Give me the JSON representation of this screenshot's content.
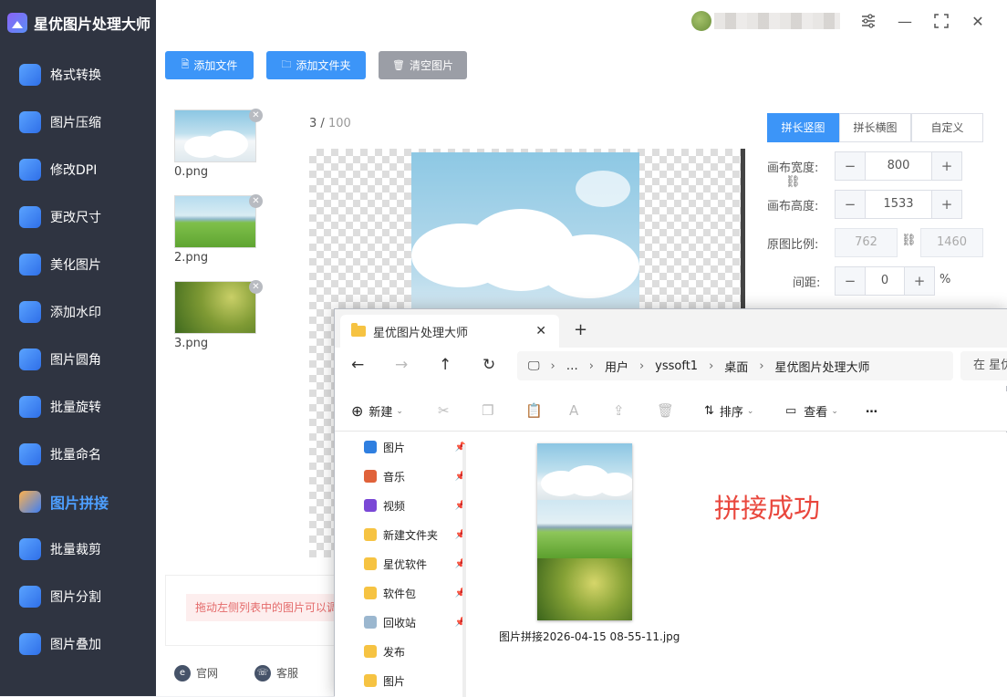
{
  "app": {
    "title": "星优图片处理大师"
  },
  "sidebar": {
    "items": [
      {
        "label": "格式转换",
        "icon": "image-convert-icon"
      },
      {
        "label": "图片压缩",
        "icon": "compress-icon"
      },
      {
        "label": "修改DPI",
        "icon": "dpi-icon"
      },
      {
        "label": "更改尺寸",
        "icon": "resize-icon"
      },
      {
        "label": "美化图片",
        "icon": "beautify-icon"
      },
      {
        "label": "添加水印",
        "icon": "watermark-icon"
      },
      {
        "label": "图片圆角",
        "icon": "round-corner-icon"
      },
      {
        "label": "批量旋转",
        "icon": "rotate-icon"
      },
      {
        "label": "批量命名",
        "icon": "rename-icon"
      },
      {
        "label": "图片拼接",
        "icon": "stitch-icon",
        "active": true
      },
      {
        "label": "批量裁剪",
        "icon": "crop-icon"
      },
      {
        "label": "图片分割",
        "icon": "split-icon"
      },
      {
        "label": "图片叠加",
        "icon": "overlay-icon"
      }
    ]
  },
  "toolbar": {
    "add_file": "添加文件",
    "add_folder": "添加文件夹",
    "clear": "清空图片"
  },
  "thumbs": [
    {
      "name": "0.png"
    },
    {
      "name": "2.png"
    },
    {
      "name": "3.png"
    }
  ],
  "preview": {
    "current": "3",
    "total": "100"
  },
  "settings": {
    "tabs": [
      "拼长竖图",
      "拼长横图",
      "自定义"
    ],
    "canvas_width_label": "画布宽度:",
    "canvas_width": "800",
    "canvas_height_label": "画布高度:",
    "canvas_height": "1533",
    "ratio_label": "原图比例:",
    "ratio_w": "762",
    "ratio_h": "1460",
    "spacing_label": "间距:",
    "spacing": "0",
    "spacing_unit": "%"
  },
  "hint": "拖动左侧列表中的图片可以调",
  "footer": {
    "website": "官网",
    "service": "客服"
  },
  "explorer": {
    "tab_title": "星优图片处理大师",
    "breadcrumb": [
      "…",
      "用户",
      "yssoft1",
      "桌面",
      "星优图片处理大师"
    ],
    "search_placeholder": "在 星优",
    "cmd": {
      "new": "新建",
      "sort": "排序",
      "view": "查看",
      "more": "…"
    },
    "nav": [
      {
        "label": "图片",
        "pinned": true,
        "color": "#2f7fe0"
      },
      {
        "label": "音乐",
        "pinned": true,
        "color": "#e0623a"
      },
      {
        "label": "视频",
        "pinned": true,
        "color": "#7a48d6"
      },
      {
        "label": "新建文件夹",
        "pinned": true,
        "color": "#f6c342"
      },
      {
        "label": "星优软件",
        "pinned": true,
        "color": "#f6c342"
      },
      {
        "label": "软件包",
        "pinned": true,
        "color": "#f6c342"
      },
      {
        "label": "回收站",
        "pinned": true,
        "color": "#9bb7cf"
      },
      {
        "label": "发布",
        "pinned": false,
        "color": "#f6c342"
      },
      {
        "label": "图片",
        "pinned": false,
        "color": "#f6c342"
      }
    ],
    "file_name": "图片拼接2026-04-15 08-55-11.jpg",
    "success_text": "拼接成功"
  }
}
